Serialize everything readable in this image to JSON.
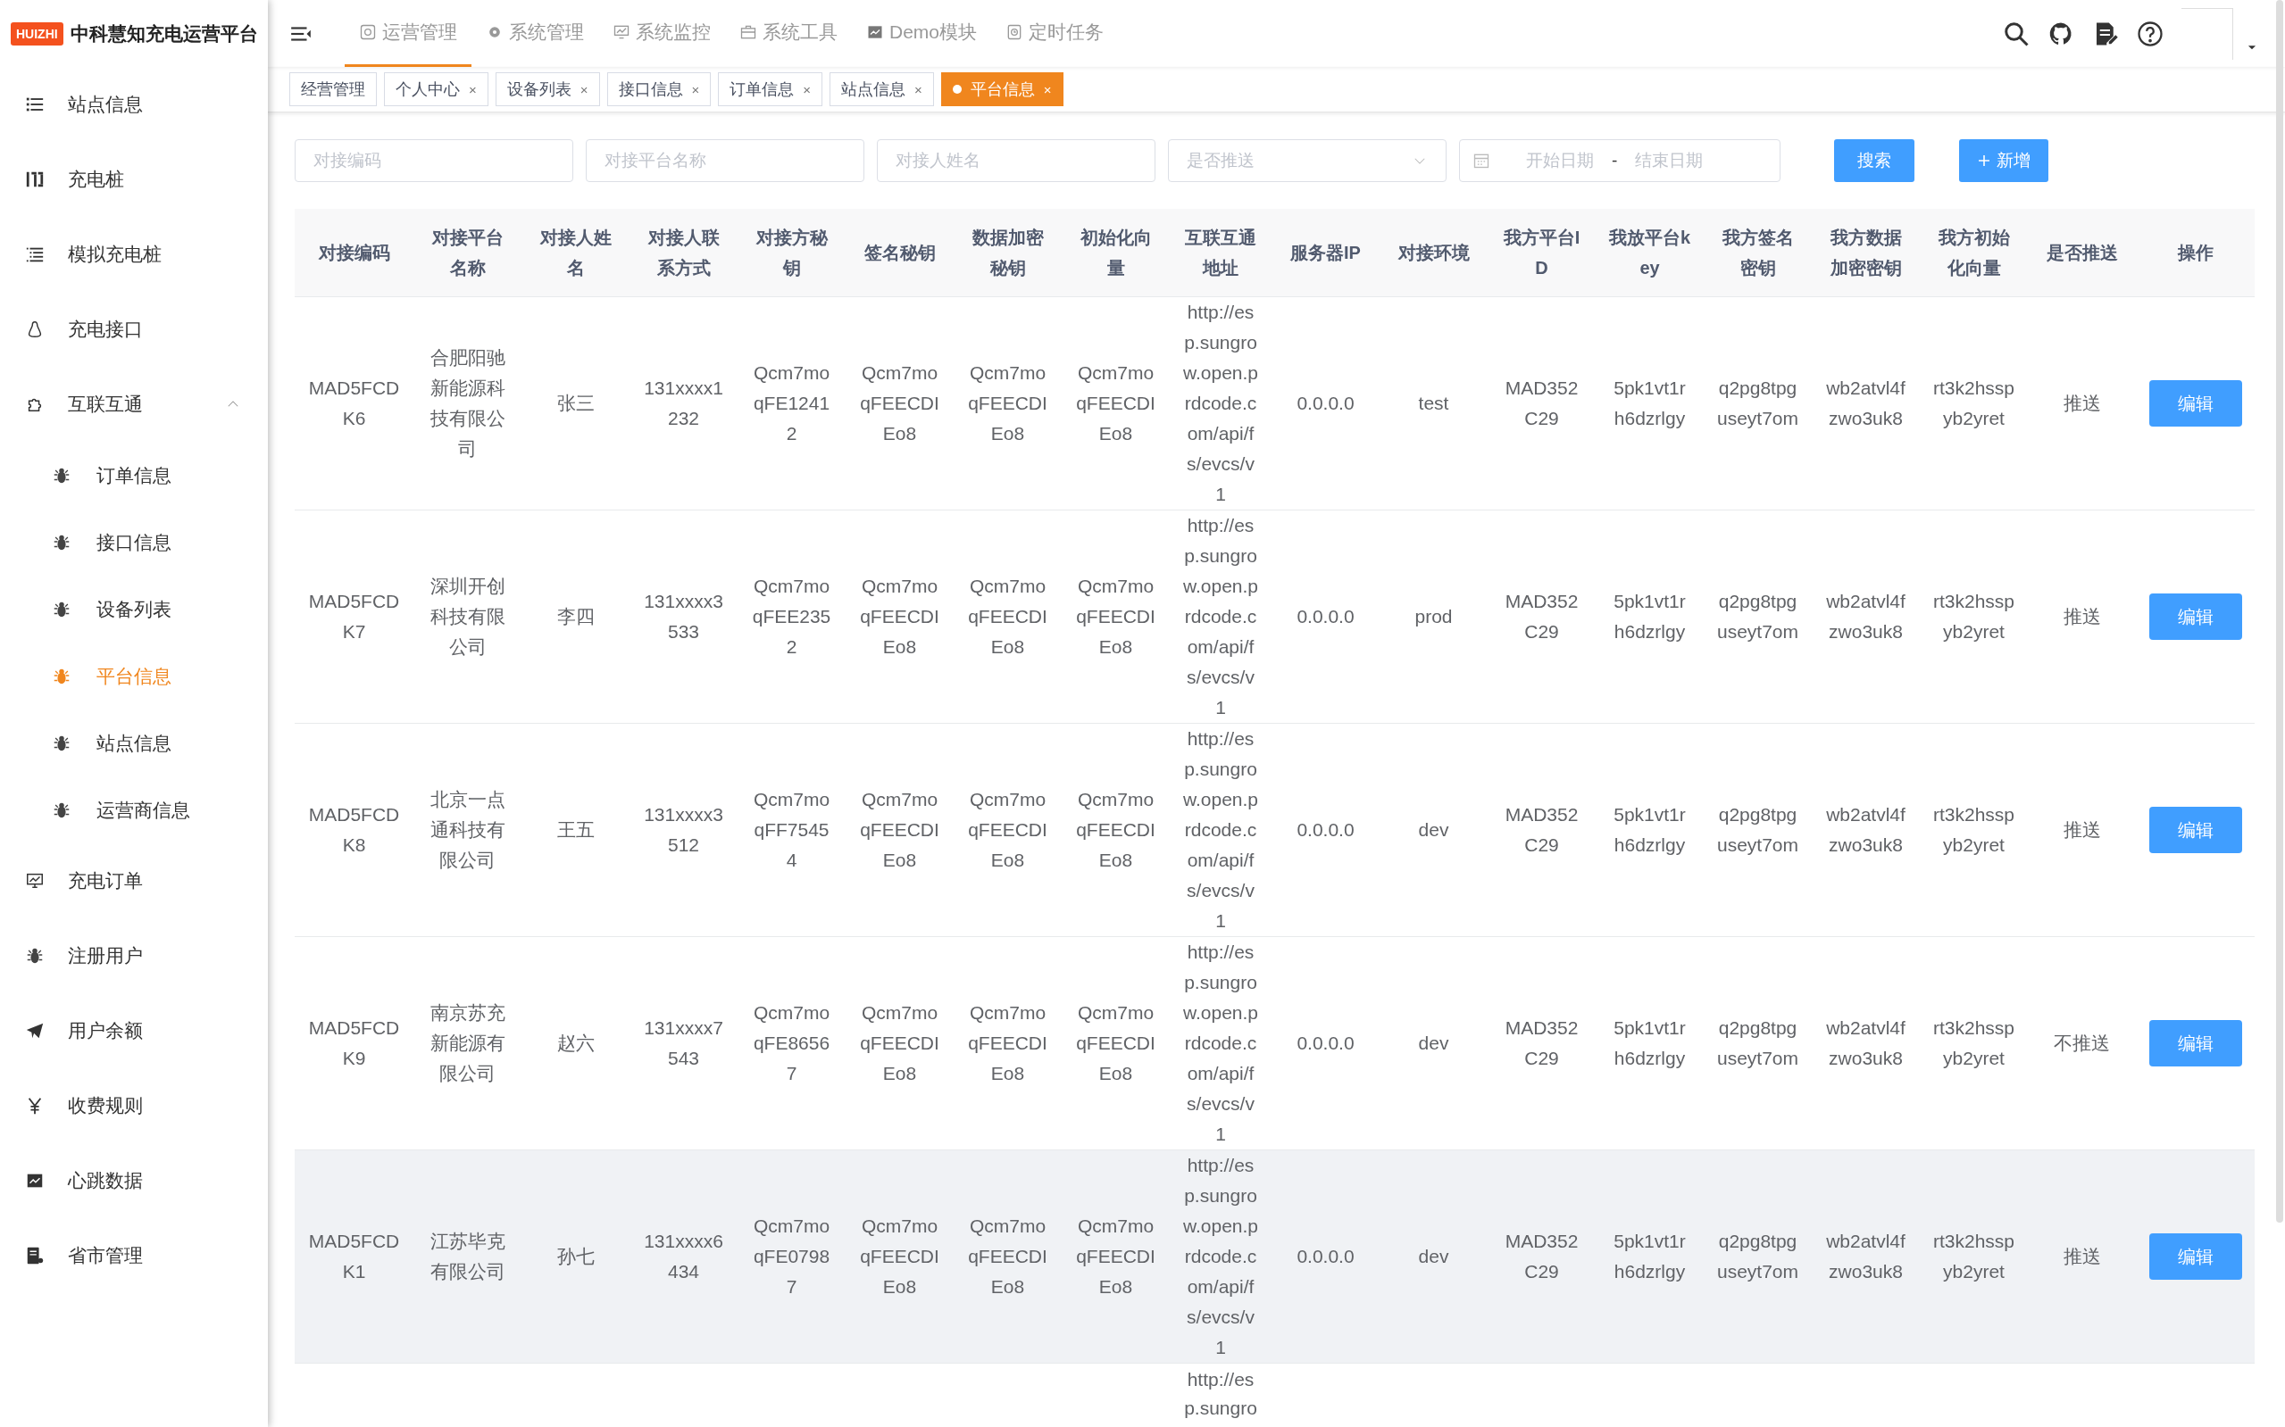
{
  "brand": {
    "logo": "HUIZHI",
    "title": "中科慧知充电运营平台"
  },
  "sidebar": {
    "items": [
      {
        "label": "站点信息",
        "selected": false
      },
      {
        "label": "充电桩",
        "selected": false
      },
      {
        "label": "模拟充电桩",
        "selected": false
      },
      {
        "label": "充电接口",
        "selected": false
      },
      {
        "label": "互联互通",
        "selected": false,
        "expanded": true,
        "children": [
          {
            "label": "订单信息",
            "selected": false
          },
          {
            "label": "接口信息",
            "selected": false
          },
          {
            "label": "设备列表",
            "selected": false
          },
          {
            "label": "平台信息",
            "selected": true
          },
          {
            "label": "站点信息",
            "selected": false
          },
          {
            "label": "运营商信息",
            "selected": false
          }
        ]
      },
      {
        "label": "充电订单",
        "selected": false
      },
      {
        "label": "注册用户",
        "selected": false
      },
      {
        "label": "用户余额",
        "selected": false
      },
      {
        "label": "收费规则",
        "selected": false
      },
      {
        "label": "心跳数据",
        "selected": false
      },
      {
        "label": "省市管理",
        "selected": false
      }
    ]
  },
  "top_menu": [
    {
      "label": "运营管理",
      "selected": true
    },
    {
      "label": "系统管理",
      "selected": false
    },
    {
      "label": "系统监控",
      "selected": false
    },
    {
      "label": "系统工具",
      "selected": false
    },
    {
      "label": "Demo模块",
      "selected": false
    },
    {
      "label": "定时任务",
      "selected": false
    }
  ],
  "tags": [
    {
      "label": "经营管理",
      "selected": false
    },
    {
      "label": "个人中心",
      "selected": false,
      "close": "×"
    },
    {
      "label": "设备列表",
      "selected": false,
      "close": "×"
    },
    {
      "label": "接口信息",
      "selected": false,
      "close": "×"
    },
    {
      "label": "订单信息",
      "selected": false,
      "close": "×"
    },
    {
      "label": "站点信息",
      "selected": false,
      "close": "×"
    },
    {
      "label": "平台信息",
      "selected": true,
      "close": "×"
    }
  ],
  "filters": {
    "code": {
      "placeholder": "对接编码"
    },
    "platform": {
      "placeholder": "对接平台名称"
    },
    "person": {
      "placeholder": "对接人姓名"
    },
    "push": {
      "placeholder": "是否推送"
    },
    "date_range": {
      "start_placeholder": "开始日期",
      "separator": "-",
      "end_placeholder": "结束日期"
    },
    "search_button": "搜索",
    "add_button": "新增"
  },
  "table": {
    "columns": [
      "对接编码",
      "对接平台名称",
      "对接人姓名",
      "对接人联系方式",
      "对接方秘钥",
      "签名秘钥",
      "数据加密秘钥",
      "初始化向量",
      "互联互通地址",
      "服务器IP",
      "对接环境",
      "我方平台ID",
      "我放平台key",
      "我方签名密钥",
      "我方数据加密密钥",
      "我方初始化向量",
      "是否推送",
      "操作"
    ],
    "rows": [
      {
        "highlighted": false,
        "cells": [
          "MAD5FCDK6",
          "合肥阳驰新能源科技有限公司",
          "张三",
          "131xxxx1232",
          "Qcm7moqFE12412",
          "Qcm7moqFEECDIEo8",
          "Qcm7moqFEECDIEo8",
          "Qcm7moqFEECDIEo8",
          "http://esp.sungrow.open.prdcode.com/api/fs/evcs/v1",
          "0.0.0.0",
          "test",
          "MAD352C29",
          "5pk1vt1rh6dzrlgy",
          "q2pg8tpguseyt7om",
          "wb2atvl4fzwo3uk8",
          "rt3k2hsspyb2yret",
          "推送"
        ],
        "action": "编辑"
      },
      {
        "highlighted": false,
        "cells": [
          "MAD5FCDK7",
          "深圳开创科技有限公司",
          "李四",
          "131xxxx3533",
          "Qcm7moqFEE2352",
          "Qcm7moqFEECDIEo8",
          "Qcm7moqFEECDIEo8",
          "Qcm7moqFEECDIEo8",
          "http://esp.sungrow.open.prdcode.com/api/fs/evcs/v1",
          "0.0.0.0",
          "prod",
          "MAD352C29",
          "5pk1vt1rh6dzrlgy",
          "q2pg8tpguseyt7om",
          "wb2atvl4fzwo3uk8",
          "rt3k2hsspyb2yret",
          "推送"
        ],
        "action": "编辑"
      },
      {
        "highlighted": false,
        "cells": [
          "MAD5FCDK8",
          "北京一点通科技有限公司",
          "王五",
          "131xxxx3512",
          "Qcm7moqFF75454",
          "Qcm7moqFEECDIEo8",
          "Qcm7moqFEECDIEo8",
          "Qcm7moqFEECDIEo8",
          "http://esp.sungrow.open.prdcode.com/api/fs/evcs/v1",
          "0.0.0.0",
          "dev",
          "MAD352C29",
          "5pk1vt1rh6dzrlgy",
          "q2pg8tpguseyt7om",
          "wb2atvl4fzwo3uk8",
          "rt3k2hsspyb2yret",
          "推送"
        ],
        "action": "编辑"
      },
      {
        "highlighted": false,
        "cells": [
          "MAD5FCDK9",
          "南京苏充新能源有限公司",
          "赵六",
          "131xxxx7543",
          "Qcm7moqFE86567",
          "Qcm7moqFEECDIEo8",
          "Qcm7moqFEECDIEo8",
          "Qcm7moqFEECDIEo8",
          "http://esp.sungrow.open.prdcode.com/api/fs/evcs/v1",
          "0.0.0.0",
          "dev",
          "MAD352C29",
          "5pk1vt1rh6dzrlgy",
          "q2pg8tpguseyt7om",
          "wb2atvl4fzwo3uk8",
          "rt3k2hsspyb2yret",
          "不推送"
        ],
        "action": "编辑"
      },
      {
        "highlighted": true,
        "cells": [
          "MAD5FCDK1",
          "江苏毕克有限公司",
          "孙七",
          "131xxxx6434",
          "Qcm7moqFE07987",
          "Qcm7moqFEECDIEo8",
          "Qcm7moqFEECDIEo8",
          "Qcm7moqFEECDIEo8",
          "http://esp.sungrow.open.prdcode.com/api/fs/evcs/v1",
          "0.0.0.0",
          "dev",
          "MAD352C29",
          "5pk1vt1rh6dzrlgy",
          "q2pg8tpguseyt7om",
          "wb2atvl4fzwo3uk8",
          "rt3k2hsspyb2yret",
          "推送"
        ],
        "action": "编辑"
      }
    ],
    "partial_row": {
      "column_9": "http://esp.sungro"
    }
  }
}
